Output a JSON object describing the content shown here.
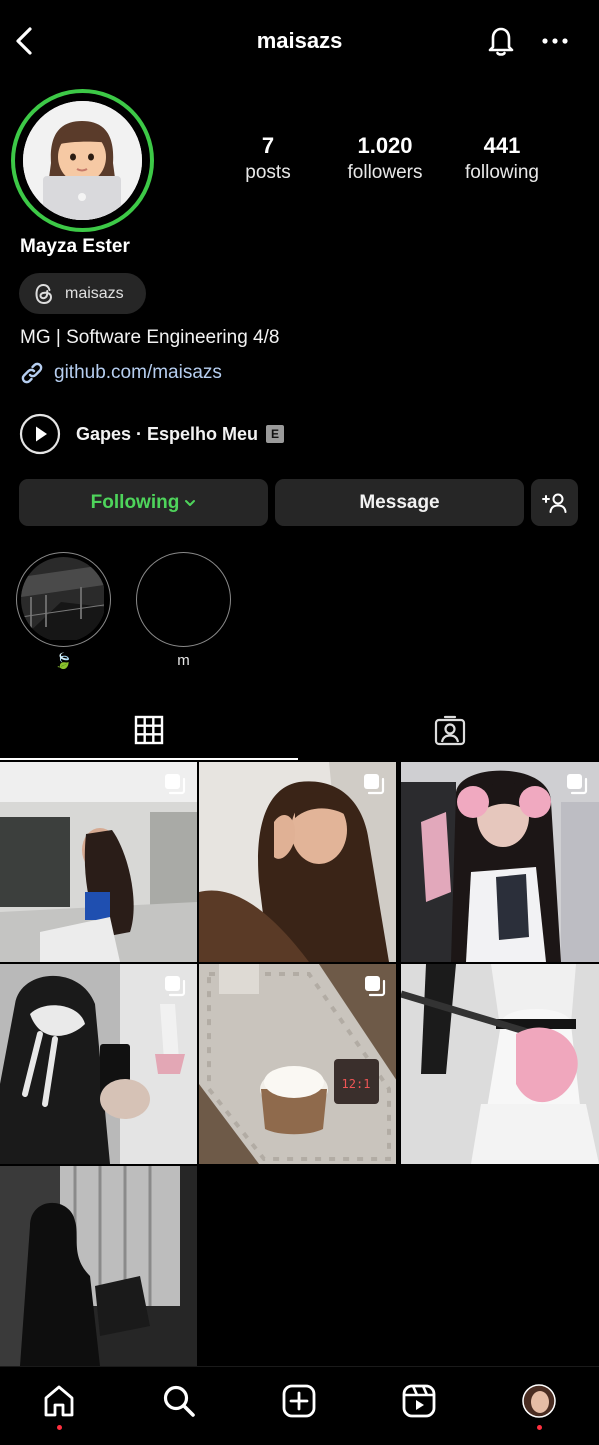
{
  "header": {
    "username": "maisazs"
  },
  "profile": {
    "display_name": "Mayza Ester",
    "threads_handle": "maisazs",
    "bio": "MG | Software Engineering 4/8",
    "link": "github.com/maisazs",
    "music": {
      "title": "Gapes · Espelho Meu",
      "explicit_badge": "E"
    },
    "story_ring_color": "#3dc947"
  },
  "stats": [
    {
      "value": "7",
      "label": "posts"
    },
    {
      "value": "1.020",
      "label": "followers"
    },
    {
      "value": "441",
      "label": "following"
    }
  ],
  "actions": {
    "following_label": "Following",
    "message_label": "Message"
  },
  "highlights": [
    {
      "label": "🍃"
    },
    {
      "label": "m"
    }
  ],
  "tabs": [
    {
      "icon": "grid-icon",
      "active": true
    },
    {
      "icon": "tagged-icon",
      "active": false
    }
  ],
  "posts": [
    {
      "scene": "girl in car",
      "multiple": true
    },
    {
      "scene": "selfie long hair",
      "multiple": true
    },
    {
      "scene": "gamer headset pink",
      "multiple": true
    },
    {
      "scene": "bow mirror selfie",
      "multiple": true
    },
    {
      "scene": "coffee on table",
      "multiple": true
    },
    {
      "scene": "pink guitar",
      "multiple": false
    },
    {
      "scene": "window silhouette",
      "multiple": false
    }
  ],
  "bottom_nav": [
    {
      "icon": "home-icon",
      "notification_dot": true
    },
    {
      "icon": "search-icon",
      "notification_dot": false
    },
    {
      "icon": "create-icon",
      "notification_dot": false
    },
    {
      "icon": "reels-icon",
      "notification_dot": false
    },
    {
      "icon": "profile-avatar",
      "notification_dot": true
    }
  ],
  "colors": {
    "accent_green": "#4ed45b",
    "link_blue": "#b6cef0",
    "button_bg": "#262626",
    "notification_dot": "#ff3040"
  }
}
